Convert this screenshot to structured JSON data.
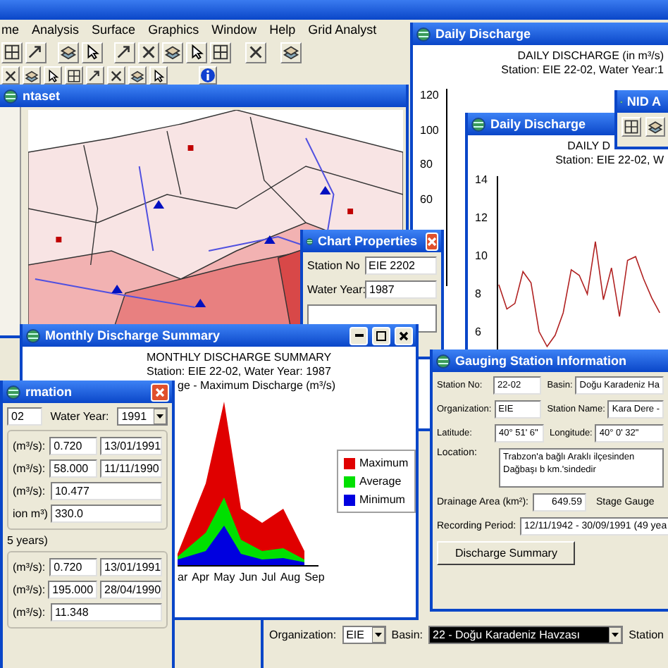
{
  "menu": [
    {
      "label": "me"
    },
    {
      "label": "Analysis"
    },
    {
      "label": "Surface"
    },
    {
      "label": "Graphics"
    },
    {
      "label": "Window"
    },
    {
      "label": "Help"
    },
    {
      "label": "Grid Analyst"
    }
  ],
  "dataset_window": {
    "title": "ntaset"
  },
  "daily_back": {
    "title": "Daily Discharge",
    "heading": "DAILY DISCHARGE (in m³/s)",
    "subtitle": "Station: EIE 22-02, Water Year:1",
    "yticks": [
      "120",
      "100",
      "80",
      "60"
    ]
  },
  "nid_window": {
    "title": "NID A"
  },
  "daily_front": {
    "title": "Daily Discharge",
    "heading": "DAILY D",
    "subtitle": "Station: EIE 22-02, W",
    "chart_data": {
      "type": "line",
      "ylim": [
        5,
        14.3
      ],
      "yticks": [
        6,
        8,
        10,
        12,
        14
      ],
      "series": [
        {
          "color": "#b02020",
          "values": [
            8.5,
            7.2,
            7.5,
            9.2,
            8.6,
            6,
            5.2,
            5.8,
            7,
            9.3,
            9,
            8,
            10.8,
            7.7,
            9.4,
            6.8,
            9.8,
            10,
            8.8,
            7.8,
            7
          ]
        }
      ]
    }
  },
  "chart_properties": {
    "title": "Chart Properties",
    "fields": [
      {
        "label": "Station No",
        "value": "EIE 2202"
      },
      {
        "label": "Water Year:",
        "value": "1987"
      }
    ]
  },
  "monthly_summary": {
    "title": "Monthly Discharge Summary",
    "heading": "MONTHLY DISCHARGE SUMMARY",
    "subtitle": "Station: EIE 22-02, Water Year: 1987",
    "caption": "ge - Maximum Discharge (m³/s)",
    "months": [
      "ar",
      "Apr",
      "May",
      "Jun",
      "Jul",
      "Aug",
      "Sep"
    ],
    "legend": [
      {
        "label": "Maximum",
        "color": "#e00000"
      },
      {
        "label": "Average",
        "color": "#00e000"
      },
      {
        "label": "Minimum",
        "color": "#0000e0"
      }
    ]
  },
  "station_info": {
    "title": "rmation",
    "station": "02",
    "water_year_label": "Water Year:",
    "water_year": "1991",
    "rows": [
      {
        "label": "(m³/s):",
        "value": "0.720",
        "date": "13/01/1991"
      },
      {
        "label": "(m³/s):",
        "value": "58.000",
        "date": "11/11/1990"
      },
      {
        "label": "(m³/s):",
        "value": "10.477"
      },
      {
        "label": "ion m³)",
        "value": "330.0"
      }
    ],
    "group_label": "5 years)",
    "rows2": [
      {
        "label": "(m³/s):",
        "value": "0.720",
        "date": "13/01/1991"
      },
      {
        "label": "(m³/s):",
        "value": "195.000",
        "date": "28/04/1990"
      },
      {
        "label": "(m³/s):",
        "value": "11.348"
      }
    ]
  },
  "gauging": {
    "title": "Gauging Station Information",
    "pairs": [
      [
        {
          "label": "Station No:",
          "value": "22-02"
        },
        {
          "label": "Basin:",
          "value": "Doğu Karadeniz Ha"
        }
      ],
      [
        {
          "label": "Organization:",
          "value": "EIE"
        },
        {
          "label": "Station Name:",
          "value": "Kara Dere -"
        }
      ],
      [
        {
          "label": "Latitude:",
          "value": "40° 51' 6\""
        },
        {
          "label": "Longitude:",
          "value": "40° 0' 32\""
        }
      ]
    ],
    "location_label": "Location:",
    "location": "Trabzon'a bağlı Araklı ilçesinden Dağbaşı b km.'sindedir",
    "area_label": "Drainage Area (km²):",
    "area": "649.59",
    "stage_gauge": "Stage Gauge",
    "period_label": "Recording Period:",
    "period": "12/11/1942 - 30/09/1991  (49 yea",
    "button": "Discharge Summary"
  },
  "filter_bar": {
    "org_label": "Organization:",
    "org": "EIE",
    "basin_label": "Basin:",
    "basin": "22 - Doğu Karadeniz Havzası",
    "station_label": "Station"
  }
}
